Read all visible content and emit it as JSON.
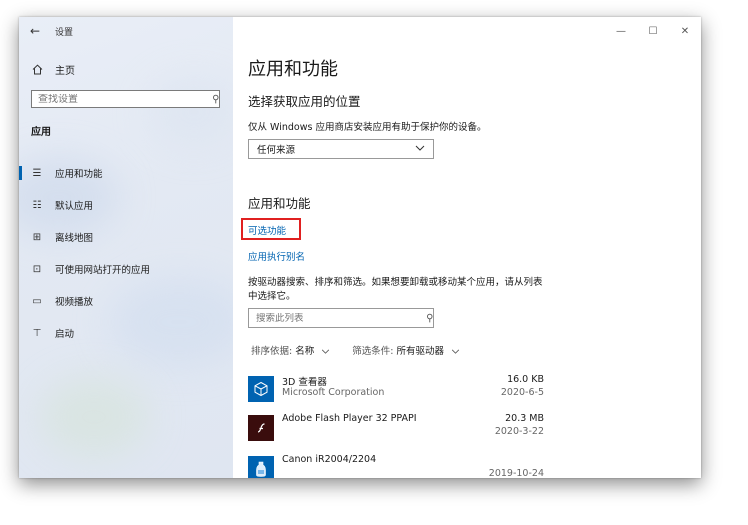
{
  "window": {
    "app_title": "设置",
    "back_glyph": "←",
    "minimize_glyph": "—",
    "maximize_glyph": "☐",
    "close_glyph": "✕"
  },
  "sidebar": {
    "home_label": "主页",
    "search_placeholder": "查找设置",
    "section_label": "应用",
    "items": [
      {
        "label": "应用和功能",
        "icon": "apps-features-icon",
        "glyph": "☰",
        "active": true
      },
      {
        "label": "默认应用",
        "icon": "default-apps-icon",
        "glyph": "☷",
        "active": false
      },
      {
        "label": "离线地图",
        "icon": "offline-maps-icon",
        "glyph": "⊞",
        "active": false
      },
      {
        "label": "可使用网站打开的应用",
        "icon": "apps-for-websites-icon",
        "glyph": "⊡",
        "active": false
      },
      {
        "label": "视频播放",
        "icon": "video-playback-icon",
        "glyph": "▭",
        "active": false
      },
      {
        "label": "启动",
        "icon": "startup-icon",
        "glyph": "⊤",
        "active": false
      }
    ]
  },
  "main": {
    "page_title": "应用和功能",
    "install_location_heading": "选择获取应用的位置",
    "install_location_desc": "仅从 Windows 应用商店安装应用有助于保护你的设备。",
    "install_source_value": "任何来源",
    "apps_heading": "应用和功能",
    "optional_features_link": "可选功能",
    "app_alias_link": "应用执行别名",
    "search_desc": "按驱动器搜索、排序和筛选。如果想要卸载或移动某个应用，请从列表中选择它。",
    "list_search_placeholder": "搜索此列表",
    "sort_label": "排序依据: ",
    "sort_value": "名称",
    "filter_label": "筛选条件: ",
    "filter_value": "所有驱动器"
  },
  "apps": [
    {
      "name": "3D 查看器",
      "publisher": "Microsoft Corporation",
      "size": "16.0 KB",
      "date": "2020-6-5"
    },
    {
      "name": "Adobe Flash Player 32 PPAPI",
      "publisher": "",
      "size": "20.3 MB",
      "date": "2020-3-22"
    },
    {
      "name": "Canon iR2004/2204",
      "publisher": "",
      "size": "",
      "date": "2019-10-24"
    }
  ],
  "colors": {
    "accent": "#0063b1",
    "highlight_border": "#e02020",
    "flash_icon_bg": "#3a0d0d"
  }
}
